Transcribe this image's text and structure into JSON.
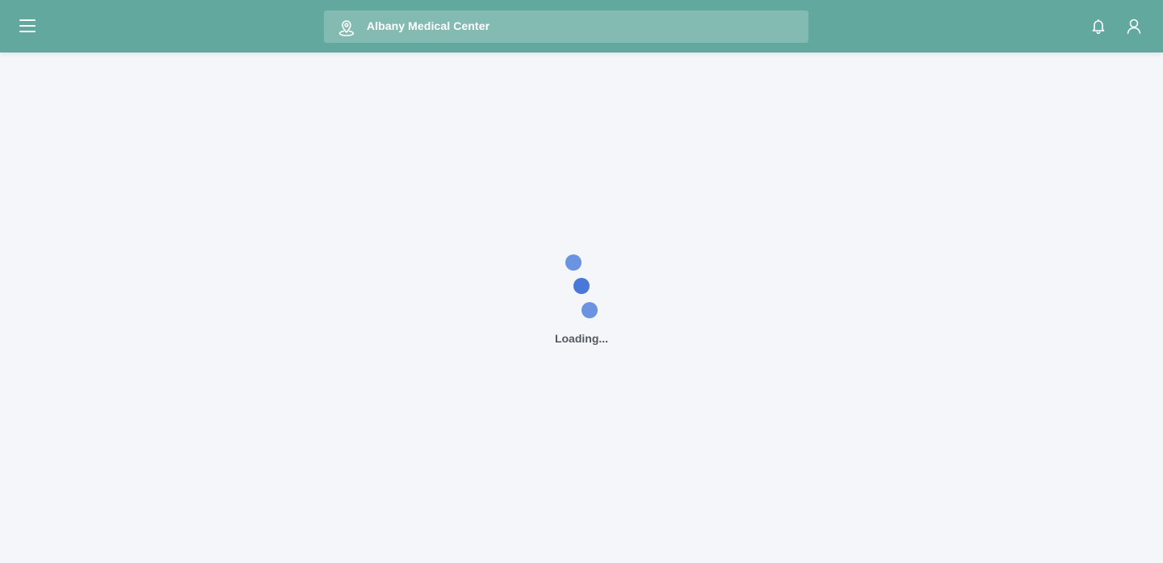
{
  "header": {
    "menu_icon": "hamburger-menu-icon",
    "location": {
      "icon": "location-pin-icon",
      "name": "Albany Medical Center"
    },
    "notifications_icon": "bell-icon",
    "profile_icon": "user-icon"
  },
  "loader": {
    "text": "Loading...",
    "dot_colors": [
      "#6b93e2",
      "#4a78d9",
      "#6b93e2"
    ]
  },
  "colors": {
    "header_bg": "#62a89f",
    "location_bg": "#83bab2",
    "page_bg": "#f4f6fa"
  }
}
